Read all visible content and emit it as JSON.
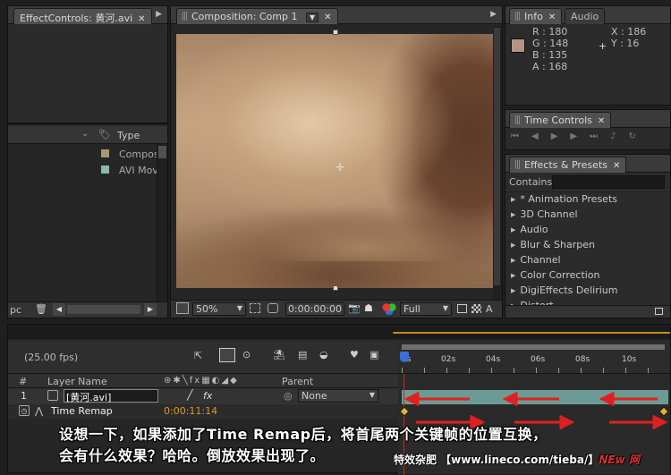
{
  "effect_controls": {
    "tab_label": "EffectControls: 黄河.avi"
  },
  "project": {
    "type_header": "Type",
    "rows": [
      {
        "type": "Compos",
        "color": "#a59c6e"
      },
      {
        "type": "AVI Mov",
        "color": "#8ab8ad"
      }
    ],
    "bottom_label": "pc"
  },
  "composition": {
    "tab_label": "Composition: Comp 1",
    "zoom": "50%",
    "timecode": "0:00:00:00",
    "quality": "Full"
  },
  "info": {
    "tab_info": "Info",
    "tab_audio": "Audio",
    "r": "R : 180",
    "g": "G : 148",
    "b": "B : 135",
    "a": "A : 168",
    "x": "X : 186",
    "y": "Y : 16",
    "swatch": "#b49487"
  },
  "time_controls": {
    "tab_label": "Time Controls"
  },
  "effects_presets": {
    "tab_label": "Effects & Presets",
    "contains_label": "Contains:",
    "items": [
      "* Animation Presets",
      "3D Channel",
      "Audio",
      "Blur & Sharpen",
      "Channel",
      "Color Correction",
      "DigiEffects Delirium",
      "Distort"
    ]
  },
  "timeline": {
    "fps": "(25.00 fps)",
    "col_num": "#",
    "col_layer_name": "Layer Name",
    "col_parent": "Parent",
    "layer_num": "1",
    "layer_name": "[黄河.avi]",
    "parent_value": "None",
    "prop_name": "Time Remap",
    "prop_value": "0:00:11:14",
    "ruler": [
      "0s",
      "02s",
      "04s",
      "06s",
      "08s",
      "10s"
    ]
  },
  "caption": {
    "line1": "设想一下，如果添加了Time Remap后，将首尾两个关键帧的位置互换，",
    "line2": "会有什么效果？哈哈。倒放效果出现了。",
    "watermark": "特效杂肥 【www.lineco.com/tieba/】",
    "watermark_tail": "NEw 网"
  }
}
